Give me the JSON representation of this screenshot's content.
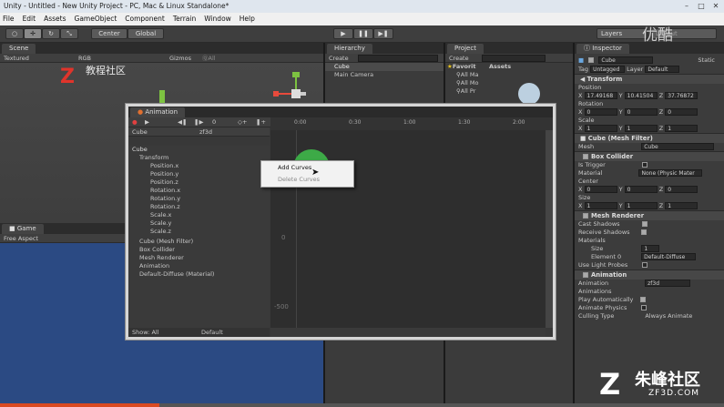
{
  "window": {
    "title": "Unity - Untitled - New Unity Project - PC, Mac & Linux Standalone*"
  },
  "menu": [
    "File",
    "Edit",
    "Assets",
    "GameObject",
    "Component",
    "Terrain",
    "Window",
    "Help"
  ],
  "toolbar": {
    "center": "Center",
    "global": "Global",
    "layers": "Layers",
    "layout": "Layout"
  },
  "scene": {
    "tab": "Scene",
    "textured": "Textured",
    "rgb": "RGB",
    "gizmos": "Gizmos",
    "search": "ⓆAll"
  },
  "game": {
    "tab": "Game",
    "aspect": "Free Aspect"
  },
  "hierarchy": {
    "tab": "Hierarchy",
    "create": "Create",
    "items": [
      "Cube",
      "Main Camera"
    ]
  },
  "project": {
    "tab": "Project",
    "create": "Create",
    "favorites": "Favorit",
    "assets": "Assets",
    "fav_items": [
      "All Ma",
      "All Mo",
      "All Pr"
    ]
  },
  "animation": {
    "tab": "Animation",
    "object": "Cube",
    "clip": "zf3d",
    "time": "0",
    "ruler": [
      "0:00",
      "0:30",
      "1:00",
      "1:30",
      "2:00"
    ],
    "ymarks": [
      "0",
      "-500"
    ],
    "tree": [
      "Cube",
      "Transform",
      "Position.x",
      "Position.y",
      "Position.z",
      "Rotation.x",
      "Rotation.y",
      "Rotation.z",
      "Scale.x",
      "Scale.y",
      "Scale.z",
      "Cube (Mesh Filter)",
      "Box Collider",
      "Mesh Renderer",
      "Animation",
      "Default-Diffuse (Material)"
    ],
    "footer_left": "Show: All",
    "footer_mid": "Default",
    "context_menu": [
      "Add Curves",
      "Delete Curves"
    ]
  },
  "inspector": {
    "tab": "Inspector",
    "name": "Cube",
    "static": "Static",
    "tag_label": "Tag",
    "tag": "Untagged",
    "layer_label": "Layer",
    "layer": "Default",
    "transform": {
      "title": "Transform",
      "position_label": "Position",
      "position": [
        "17.49168",
        "10.41504",
        "37.76872"
      ],
      "rotation_label": "Rotation",
      "rotation": [
        "0",
        "0",
        "0"
      ],
      "scale_label": "Scale",
      "scale": [
        "1",
        "1",
        "1"
      ]
    },
    "mesh_filter": {
      "title": "Cube (Mesh Filter)",
      "mesh_label": "Mesh",
      "mesh": "Cube"
    },
    "box_collider": {
      "title": "Box Collider",
      "trigger_label": "Is Trigger",
      "material_label": "Material",
      "material": "None (Physic Mater",
      "center_label": "Center",
      "center": [
        "0",
        "0",
        "0"
      ],
      "size_label": "Size",
      "size": [
        "1",
        "1",
        "1"
      ]
    },
    "mesh_renderer": {
      "title": "Mesh Renderer",
      "cast_label": "Cast Shadows",
      "receive_label": "Receive Shadows",
      "materials_label": "Materials",
      "size_label": "Size",
      "size": "1",
      "element_label": "Element 0",
      "element": "Default-Diffuse",
      "probes_label": "Use Light Probes"
    },
    "animation": {
      "title": "Animation",
      "anim_label": "Animation",
      "anim": "zf3d",
      "anims_label": "Animations",
      "play_label": "Play Automatically",
      "physics_label": "Animate Physics",
      "culling_label": "Culling Type",
      "culling": "Always Animate"
    }
  },
  "watermark": {
    "top": "优酷",
    "site_cn": "朱峰社区",
    "site_en": "ZF3D.COM",
    "scene_logo": "教程社区"
  }
}
